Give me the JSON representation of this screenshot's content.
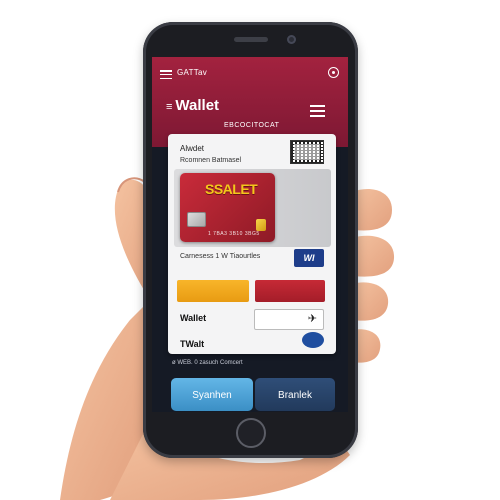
{
  "header": {
    "status_label": "GATTav",
    "title_prefix": "≡",
    "title": "Wallet",
    "subtitle": "EBCOCITOCAT"
  },
  "panel": {
    "title": "Alwdet",
    "subtitle": "Rcomnen Batmasel",
    "card": {
      "brand": "SSALET",
      "number": "1 7BA3 3B10 3BG5"
    },
    "caption": "Carnesess 1 W Tiaourtles",
    "badge": "WI",
    "wallet_label": "Wallet",
    "wallet_label_2": "TWalt"
  },
  "footer": {
    "note": "ø WEB. 0 zasuch Comcert",
    "primary_button": "Syanhen",
    "secondary_button": "Branlek"
  },
  "colors": {
    "header": "#8e1c38",
    "card": "#b72434",
    "primary_button": "#4ea4d8",
    "secondary_button": "#29446a"
  }
}
